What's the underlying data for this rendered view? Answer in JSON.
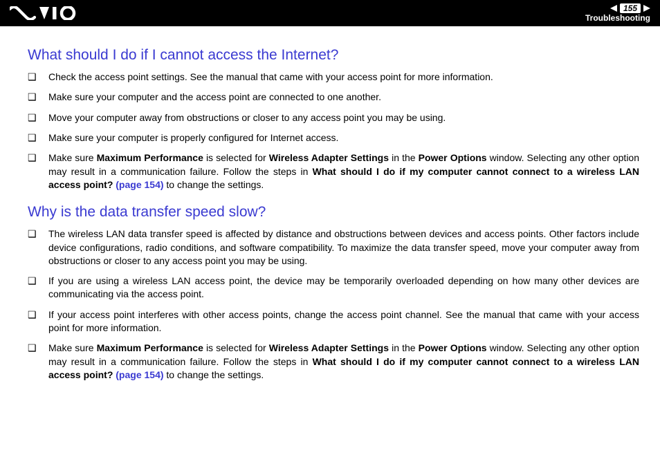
{
  "header": {
    "page_number": "155",
    "section": "Troubleshooting"
  },
  "q1": {
    "heading": "What should I do if I cannot access the Internet?",
    "items": {
      "i0": "Check the access point settings. See the manual that came with your access point for more information.",
      "i1": "Make sure your computer and the access point are connected to one another.",
      "i2": "Move your computer away from obstructions or closer to any access point you may be using.",
      "i3": "Make sure your computer is properly configured for Internet access.",
      "i4": {
        "t0": "Make sure ",
        "b0": "Maximum Performance",
        "t1": " is selected for ",
        "b1": "Wireless Adapter Settings",
        "t2": " in the ",
        "b2": "Power Options",
        "t3": " window. Selecting any other option may result in a communication failure. Follow the steps in ",
        "b3": "What should I do if my computer cannot connect to a wireless LAN access point? ",
        "link": "(page 154)",
        "t4": " to change the settings."
      }
    }
  },
  "q2": {
    "heading": "Why is the data transfer speed slow?",
    "items": {
      "i0": "The wireless LAN data transfer speed is affected by distance and obstructions between devices and access points. Other factors include device configurations, radio conditions, and software compatibility. To maximize the data transfer speed, move your computer away from obstructions or closer to any access point you may be using.",
      "i1": "If you are using a wireless LAN access point, the device may be temporarily overloaded depending on how many other devices are communicating via the access point.",
      "i2": "If your access point interferes with other access points, change the access point channel. See the manual that came with your access point for more information.",
      "i3": {
        "t0": "Make sure ",
        "b0": "Maximum Performance",
        "t1": " is selected for ",
        "b1": "Wireless Adapter Settings",
        "t2": " in the ",
        "b2": "Power Options",
        "t3": " window. Selecting any other option may result in a communication failure. Follow the steps in ",
        "b3": "What should I do if my computer cannot connect to a wireless LAN access point? ",
        "link": "(page 154)",
        "t4": " to change the settings."
      }
    }
  }
}
